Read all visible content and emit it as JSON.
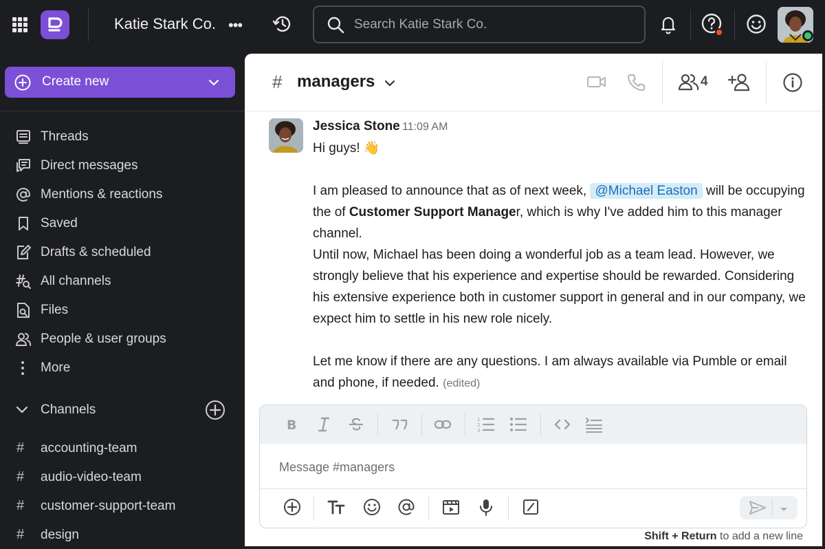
{
  "topbar": {
    "workspace_name": "Katie Stark Co.",
    "workspace_menu": "•••",
    "search_placeholder": "Search Katie Stark Co."
  },
  "sidebar": {
    "create_label": "Create new",
    "nav_items": [
      {
        "label": "Threads",
        "icon": "threads-icon"
      },
      {
        "label": "Direct messages",
        "icon": "direct-messages-icon"
      },
      {
        "label": "Mentions & reactions",
        "icon": "at-icon"
      },
      {
        "label": "Saved",
        "icon": "bookmark-icon"
      },
      {
        "label": "Drafts & scheduled",
        "icon": "draft-icon"
      },
      {
        "label": "All channels",
        "icon": "channel-search-icon"
      },
      {
        "label": "Files",
        "icon": "file-search-icon"
      },
      {
        "label": "People & user groups",
        "icon": "people-icon"
      },
      {
        "label": "More",
        "icon": "more-vertical-icon"
      }
    ],
    "channels_label": "Channels",
    "channels": [
      "accounting-team",
      "audio-video-team",
      "customer-support-team",
      "design"
    ]
  },
  "channel": {
    "hash": "#",
    "name": "managers",
    "member_count": "4"
  },
  "message": {
    "author": "Jessica Stone",
    "time": "11:09 AM",
    "greeting": "Hi guys!",
    "emoji": "👋",
    "p1_before": "I am pleased to announce that as of next week, ",
    "mention": "@Michael Easton",
    "p1_after1": " will be occupying the of ",
    "p1_bold": "Customer Support Manage",
    "p1_after2": "r, which is why I've added him to this manager channel.",
    "p2": "Until now, Michael has been doing a wonderful job as a team lead. However, we strongly believe that his experience and expertise should be rewarded. Considering his extensive experience both in customer support in general and in our company, we expect him to settle in his new role nicely.",
    "p3": "Let me know if there are any questions. I am always available via Pumble or email and phone, if needed.",
    "edited": "(edited)"
  },
  "composer": {
    "placeholder": "Message #managers",
    "hint_keys": "Shift + Return",
    "hint_text": " to add a new line"
  },
  "colors": {
    "accent": "#7b4fd6",
    "sidebar_bg": "#1b1d21",
    "mention_bg": "#d4ecfa",
    "mention_text": "#1b6fb8",
    "online": "#3ec46d",
    "notification": "#f2501b"
  }
}
